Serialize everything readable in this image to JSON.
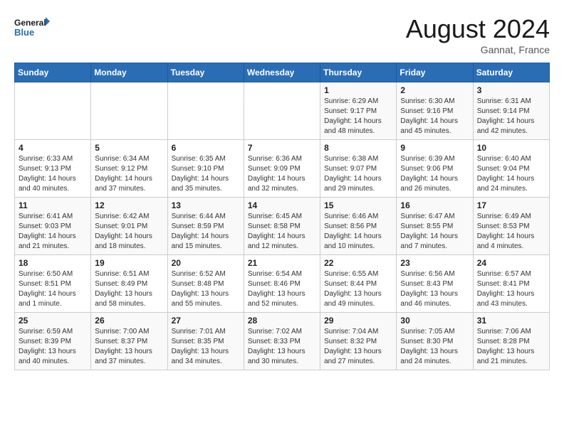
{
  "header": {
    "logo_line1": "General",
    "logo_line2": "Blue",
    "month_year": "August 2024",
    "location": "Gannat, France"
  },
  "weekdays": [
    "Sunday",
    "Monday",
    "Tuesday",
    "Wednesday",
    "Thursday",
    "Friday",
    "Saturday"
  ],
  "weeks": [
    [
      {
        "day": "",
        "info": ""
      },
      {
        "day": "",
        "info": ""
      },
      {
        "day": "",
        "info": ""
      },
      {
        "day": "",
        "info": ""
      },
      {
        "day": "1",
        "info": "Sunrise: 6:29 AM\nSunset: 9:17 PM\nDaylight: 14 hours and 48 minutes."
      },
      {
        "day": "2",
        "info": "Sunrise: 6:30 AM\nSunset: 9:16 PM\nDaylight: 14 hours and 45 minutes."
      },
      {
        "day": "3",
        "info": "Sunrise: 6:31 AM\nSunset: 9:14 PM\nDaylight: 14 hours and 42 minutes."
      }
    ],
    [
      {
        "day": "4",
        "info": "Sunrise: 6:33 AM\nSunset: 9:13 PM\nDaylight: 14 hours and 40 minutes."
      },
      {
        "day": "5",
        "info": "Sunrise: 6:34 AM\nSunset: 9:12 PM\nDaylight: 14 hours and 37 minutes."
      },
      {
        "day": "6",
        "info": "Sunrise: 6:35 AM\nSunset: 9:10 PM\nDaylight: 14 hours and 35 minutes."
      },
      {
        "day": "7",
        "info": "Sunrise: 6:36 AM\nSunset: 9:09 PM\nDaylight: 14 hours and 32 minutes."
      },
      {
        "day": "8",
        "info": "Sunrise: 6:38 AM\nSunset: 9:07 PM\nDaylight: 14 hours and 29 minutes."
      },
      {
        "day": "9",
        "info": "Sunrise: 6:39 AM\nSunset: 9:06 PM\nDaylight: 14 hours and 26 minutes."
      },
      {
        "day": "10",
        "info": "Sunrise: 6:40 AM\nSunset: 9:04 PM\nDaylight: 14 hours and 24 minutes."
      }
    ],
    [
      {
        "day": "11",
        "info": "Sunrise: 6:41 AM\nSunset: 9:03 PM\nDaylight: 14 hours and 21 minutes."
      },
      {
        "day": "12",
        "info": "Sunrise: 6:42 AM\nSunset: 9:01 PM\nDaylight: 14 hours and 18 minutes."
      },
      {
        "day": "13",
        "info": "Sunrise: 6:44 AM\nSunset: 8:59 PM\nDaylight: 14 hours and 15 minutes."
      },
      {
        "day": "14",
        "info": "Sunrise: 6:45 AM\nSunset: 8:58 PM\nDaylight: 14 hours and 12 minutes."
      },
      {
        "day": "15",
        "info": "Sunrise: 6:46 AM\nSunset: 8:56 PM\nDaylight: 14 hours and 10 minutes."
      },
      {
        "day": "16",
        "info": "Sunrise: 6:47 AM\nSunset: 8:55 PM\nDaylight: 14 hours and 7 minutes."
      },
      {
        "day": "17",
        "info": "Sunrise: 6:49 AM\nSunset: 8:53 PM\nDaylight: 14 hours and 4 minutes."
      }
    ],
    [
      {
        "day": "18",
        "info": "Sunrise: 6:50 AM\nSunset: 8:51 PM\nDaylight: 14 hours and 1 minute."
      },
      {
        "day": "19",
        "info": "Sunrise: 6:51 AM\nSunset: 8:49 PM\nDaylight: 13 hours and 58 minutes."
      },
      {
        "day": "20",
        "info": "Sunrise: 6:52 AM\nSunset: 8:48 PM\nDaylight: 13 hours and 55 minutes."
      },
      {
        "day": "21",
        "info": "Sunrise: 6:54 AM\nSunset: 8:46 PM\nDaylight: 13 hours and 52 minutes."
      },
      {
        "day": "22",
        "info": "Sunrise: 6:55 AM\nSunset: 8:44 PM\nDaylight: 13 hours and 49 minutes."
      },
      {
        "day": "23",
        "info": "Sunrise: 6:56 AM\nSunset: 8:43 PM\nDaylight: 13 hours and 46 minutes."
      },
      {
        "day": "24",
        "info": "Sunrise: 6:57 AM\nSunset: 8:41 PM\nDaylight: 13 hours and 43 minutes."
      }
    ],
    [
      {
        "day": "25",
        "info": "Sunrise: 6:59 AM\nSunset: 8:39 PM\nDaylight: 13 hours and 40 minutes."
      },
      {
        "day": "26",
        "info": "Sunrise: 7:00 AM\nSunset: 8:37 PM\nDaylight: 13 hours and 37 minutes."
      },
      {
        "day": "27",
        "info": "Sunrise: 7:01 AM\nSunset: 8:35 PM\nDaylight: 13 hours and 34 minutes."
      },
      {
        "day": "28",
        "info": "Sunrise: 7:02 AM\nSunset: 8:33 PM\nDaylight: 13 hours and 30 minutes."
      },
      {
        "day": "29",
        "info": "Sunrise: 7:04 AM\nSunset: 8:32 PM\nDaylight: 13 hours and 27 minutes."
      },
      {
        "day": "30",
        "info": "Sunrise: 7:05 AM\nSunset: 8:30 PM\nDaylight: 13 hours and 24 minutes."
      },
      {
        "day": "31",
        "info": "Sunrise: 7:06 AM\nSunset: 8:28 PM\nDaylight: 13 hours and 21 minutes."
      }
    ]
  ]
}
